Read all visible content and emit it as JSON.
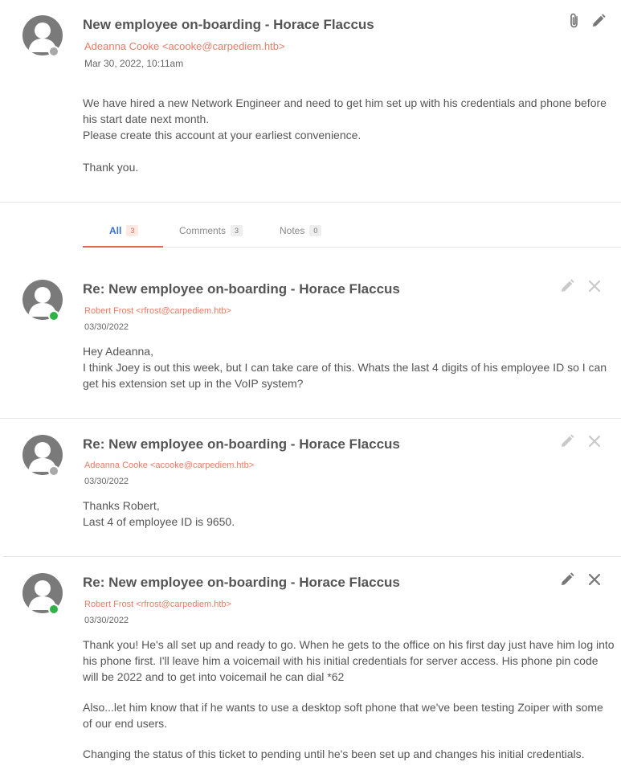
{
  "ticket": {
    "title": "New employee on-boarding - Horace Flaccus",
    "author": "Adeanna Cooke <acooke@carpediem.htb>",
    "date": "Mar 30, 2022, 10:11am",
    "body": [
      "We have hired a new Network Engineer and need to get him set up with his credentials and phone before his start date next month.",
      "Please create this account at your earliest convenience.",
      "Thank you."
    ],
    "icons": [
      "paperclip-icon",
      "pencil-icon"
    ]
  },
  "tabs": [
    {
      "label": "All",
      "count": "3",
      "active": true
    },
    {
      "label": "Comments",
      "count": "3",
      "active": false
    },
    {
      "label": "Notes",
      "count": "0",
      "active": false
    }
  ],
  "comments": [
    {
      "title": "Re: New employee on-boarding - Horace Flaccus",
      "author": "Robert Frost <rfrost@carpediem.htb>",
      "date": "03/30/2022",
      "status": "online",
      "body": [
        "Hey Adeanna,",
        "I think Joey is out this week, but I can take care of this. Whats the last 4 digits of his employee ID so I can get his extension set up in the VoIP system?"
      ]
    },
    {
      "title": "Re: New employee on-boarding - Horace Flaccus",
      "author": "Adeanna Cooke <acooke@carpediem.htb>",
      "date": "03/30/2022",
      "status": "offline",
      "body": [
        "Thanks Robert,",
        "Last 4 of employee ID is 9650."
      ]
    },
    {
      "title": "Re: New employee on-boarding - Horace Flaccus",
      "author": "Robert Frost <rfrost@carpediem.htb>",
      "date": "03/30/2022",
      "status": "online",
      "body": [
        "Thank you! He's all set up and ready to go. When he gets to the office on his first day just have him log into his phone first. I'll leave him a voicemail with his initial credentials for server access. His phone pin code will be 2022 and to get into voicemail he can dial *62",
        "Also...let him know that if he wants to use a desktop soft phone that we've been testing Zoiper with some of our end users.",
        "Changing the status of this ticket to pending until he's been set up and changes his initial credentials."
      ]
    }
  ],
  "colors": {
    "author": "#e87c66",
    "online": "#2fb344",
    "offline": "#a8a8a8",
    "active_tab": "#3a6fd8",
    "tab_underline": "#e06a4f"
  }
}
